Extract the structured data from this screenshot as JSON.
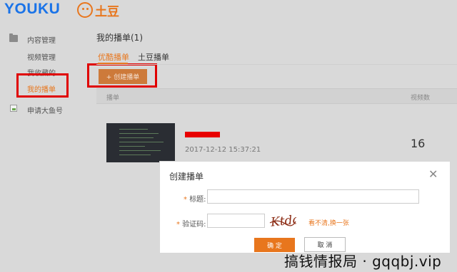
{
  "header": {
    "youku_logo": "YOUKU",
    "tudou_logo": "土豆"
  },
  "sidebar": {
    "section_title": "内容管理",
    "items": [
      {
        "label": "视频管理"
      },
      {
        "label": "我收藏的"
      },
      {
        "label": "我的播单"
      }
    ],
    "apply_label": "申请大鱼号"
  },
  "main": {
    "title": "我的播单(1)",
    "tabs": [
      {
        "label": "优酷播单",
        "active": true
      },
      {
        "label": "土豆播单",
        "active": false
      }
    ],
    "create_button": "+ 创建播单",
    "table": {
      "columns": [
        "播单",
        "视频数"
      ],
      "rows": [
        {
          "time": "2017-12-12 15:37:21",
          "count": "16"
        }
      ]
    }
  },
  "dialog": {
    "title": "创建播单",
    "close_icon": "close-icon",
    "title_field": {
      "label": "标题:",
      "value": "",
      "placeholder": ""
    },
    "captcha_field": {
      "label": "验证码:",
      "value": "",
      "placeholder": ""
    },
    "captcha_image_text": "Ktdo",
    "refresh_link": "看不清,换一张",
    "confirm_button": "确   定",
    "cancel_button": "取   消"
  },
  "watermark": "搞钱情报局 · gqqbj.vip",
  "colors": {
    "accent": "#e8761d",
    "highlight": "#e00000",
    "youku_blue": "#1a73e8"
  }
}
